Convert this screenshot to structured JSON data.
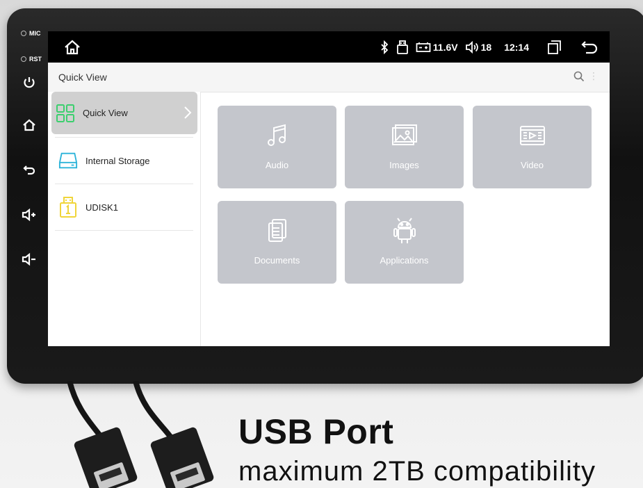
{
  "device": {
    "hw_labels": {
      "mic": "MIC",
      "rst": "RST"
    },
    "side_buttons": [
      "power-icon",
      "home-icon",
      "back-icon",
      "volume-up-icon",
      "volume-down-icon"
    ]
  },
  "statusbar": {
    "voltage": "11.6V",
    "volume": "18",
    "time": "12:14",
    "icons": [
      "home-icon",
      "bluetooth-icon",
      "usb-icon",
      "battery-icon",
      "volume-icon",
      "recents-icon",
      "back-icon"
    ]
  },
  "appbar": {
    "title": "Quick View"
  },
  "sidebar": {
    "items": [
      {
        "label": "Quick View",
        "icon": "grid-icon",
        "color": "#3ccf6e",
        "active": true
      },
      {
        "label": "Internal Storage",
        "icon": "storage-icon",
        "color": "#2bb3d9",
        "active": false
      },
      {
        "label": "UDISK1",
        "icon": "usb-drive-icon",
        "color": "#f0d53a",
        "active": false
      }
    ]
  },
  "tiles": [
    {
      "label": "Audio",
      "icon": "music-note-icon"
    },
    {
      "label": "Images",
      "icon": "images-icon"
    },
    {
      "label": "Video",
      "icon": "video-icon"
    },
    {
      "label": "Documents",
      "icon": "document-icon"
    },
    {
      "label": "Applications",
      "icon": "android-icon"
    }
  ],
  "promo": {
    "title": "USB Port",
    "subtitle": "maximum 2TB compatibility"
  },
  "colors": {
    "tile_bg": "#c4c6cc",
    "active_item_bg": "#d0d0d0",
    "statusbar_bg": "#000000"
  }
}
